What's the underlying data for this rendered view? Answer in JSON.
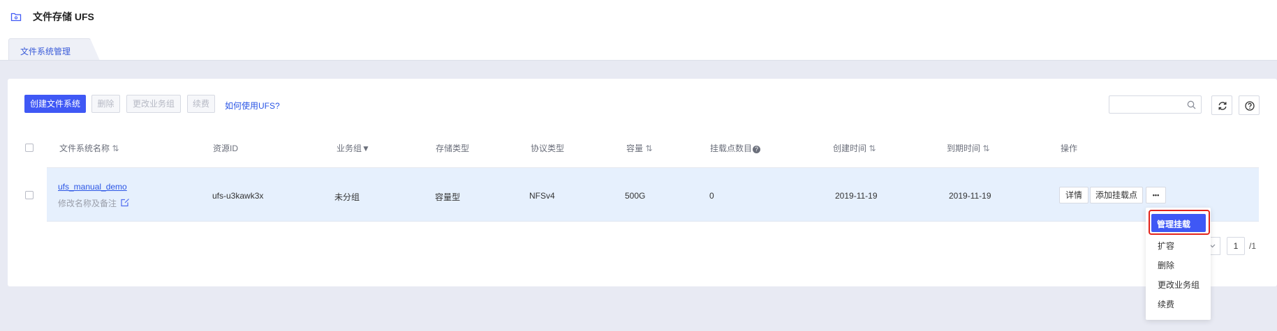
{
  "page": {
    "title": "文件存储 UFS"
  },
  "tabs": [
    {
      "label": "文件系统管理"
    }
  ],
  "toolbar": {
    "create_label": "创建文件系统",
    "delete_label": "删除",
    "change_group_label": "更改业务组",
    "renew_label": "续费",
    "help_link": "如何使用UFS?",
    "search_placeholder": ""
  },
  "table": {
    "headers": [
      "文件系统名称",
      "资源ID",
      "业务组",
      "存储类型",
      "协议类型",
      "容量",
      "挂载点数目",
      "创建时间",
      "到期时间",
      "操作"
    ],
    "rows": [
      {
        "name": "ufs_manual_demo",
        "edit_hint": "修改名称及备注",
        "resource_id": "ufs-u3kawk3x",
        "group": "未分组",
        "storage_type": "容量型",
        "protocol": "NFSv4",
        "capacity": "500G",
        "mount_count": "0",
        "created": "2019-11-19",
        "expires": "2019-11-19",
        "actions": {
          "details": "详情",
          "add_mount": "添加挂载点",
          "more": "•••"
        }
      }
    ]
  },
  "pagination": {
    "page": "1",
    "total": "/1"
  },
  "dropdown": {
    "items": [
      "管理挂载",
      "扩容",
      "删除",
      "更改业务组",
      "续费"
    ],
    "highlighted": "管理挂载"
  },
  "colors": {
    "primary": "#3f58f5",
    "link": "#2a55e5",
    "highlight_border": "#e2231a"
  }
}
